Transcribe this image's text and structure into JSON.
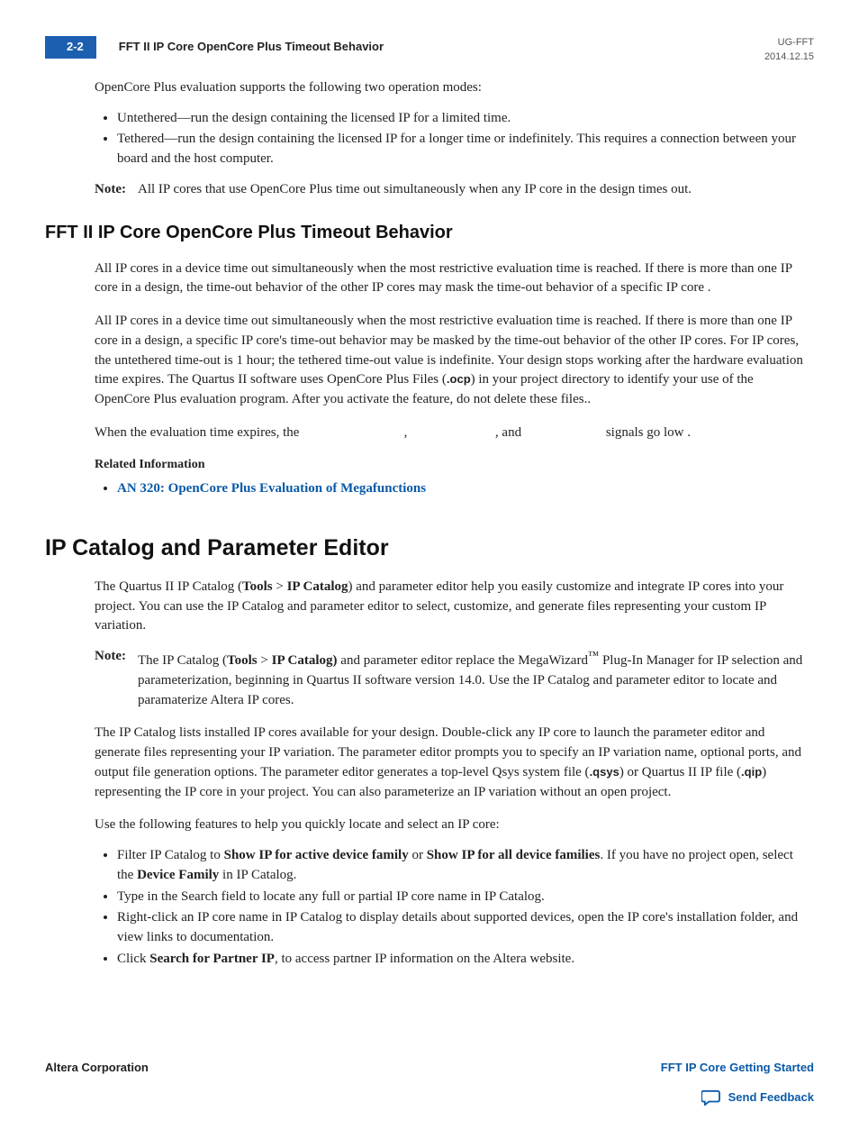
{
  "header": {
    "page_num": "2-2",
    "title": "FFT II IP Core OpenCore Plus Timeout Behavior",
    "doc_id": "UG-FFT",
    "date": "2014.12.15"
  },
  "intro": "OpenCore Plus evaluation supports the following two operation modes:",
  "modes": [
    "Untethered—run the design containing the licensed IP for a limited time.",
    "Tethered—run the design containing the licensed IP for a longer time or indefinitely. This requires a connection between your board and the host computer."
  ],
  "note1": {
    "label": "Note:",
    "text": "All IP cores that use OpenCore Plus time out simultaneously when any IP core in the design times out."
  },
  "section1": {
    "heading": "FFT II IP Core OpenCore Plus Timeout Behavior",
    "p1": "All IP cores in a device time out simultaneously when the most restrictive evaluation time is reached. If there is more than one IP core in a design, the time-out behavior of the other IP cores may mask the time-out behavior of a specific IP core .",
    "p2_a": "All IP cores in a device time out simultaneously when the most restrictive evaluation time is reached. If there is more than one IP core in a design, a specific IP core's time-out behavior may be masked by the time-out behavior of the other IP cores. For IP cores, the untethered time-out is 1 hour; the tethered time-out value is indefinite. Your design stops working after the hardware evaluation time expires. The Quartus II software uses OpenCore Plus Files (",
    "p2_ocp": ".ocp",
    "p2_b": ") in your project directory to identify your use of the OpenCore Plus evaluation program. After you activate the feature, do not delete these files..",
    "p3": "When the evaluation time expires, the                               ,                          , and                         signals go low .",
    "related_label": "Related Information",
    "related_link": "AN 320: OpenCore Plus Evaluation of Megafunctions"
  },
  "section2": {
    "heading": "IP Catalog and Parameter Editor",
    "p1_a": "The Quartus II IP Catalog (",
    "p1_tools": "Tools",
    "p1_gt": " > ",
    "p1_ipcat": "IP Catalog",
    "p1_b": ") and parameter editor help you easily customize and integrate IP cores into your project. You can use the IP Catalog and parameter editor to select, customize, and generate files representing your custom IP variation.",
    "note": {
      "label": "Note:",
      "a": "The IP Catalog (",
      "tools": "Tools",
      "gt": " > ",
      "ipcat": "IP Catalog)",
      "b": " and parameter editor replace the MegaWizard",
      "tm": "™",
      "c": " Plug-In Manager for IP selection and parameterization, beginning in Quartus II software version 14.0. Use the IP Catalog and parameter editor to locate and paramaterize Altera IP cores."
    },
    "p2_a": "The IP Catalog lists installed IP cores available for your design. Double-click any IP core to launch the parameter editor and generate files representing your IP variation. The parameter editor prompts you to specify an IP variation name, optional ports, and output file generation options. The parameter editor generates a top-level Qsys system file (",
    "p2_qsys": ".qsys",
    "p2_b": ") or Quartus II IP file (",
    "p2_qip": ".qip",
    "p2_c": ") representing the IP core in your project. You can also parameterize an IP variation without an open project.",
    "p3": "Use the following features to help you quickly locate and select an IP core:",
    "bullets": {
      "b1_a": "Filter IP Catalog to ",
      "b1_show1": "Show IP for active device family",
      "b1_or": " or ",
      "b1_show2": "Show IP for all device families",
      "b1_b": ". If you have no project open, select the ",
      "b1_df": "Device Family",
      "b1_c": " in IP Catalog.",
      "b2": "Type in the Search field to locate any full or partial IP core name in IP Catalog.",
      "b3": "Right-click an IP core name in IP Catalog to display details about supported devices, open the IP core's installation folder, and view links to documentation.",
      "b4_a": "Click ",
      "b4_sp": "Search for Partner IP",
      "b4_b": ", to access partner IP information on the Altera website."
    }
  },
  "footer": {
    "left": "Altera Corporation",
    "right": "FFT IP Core Getting Started",
    "feedback": "Send Feedback"
  }
}
